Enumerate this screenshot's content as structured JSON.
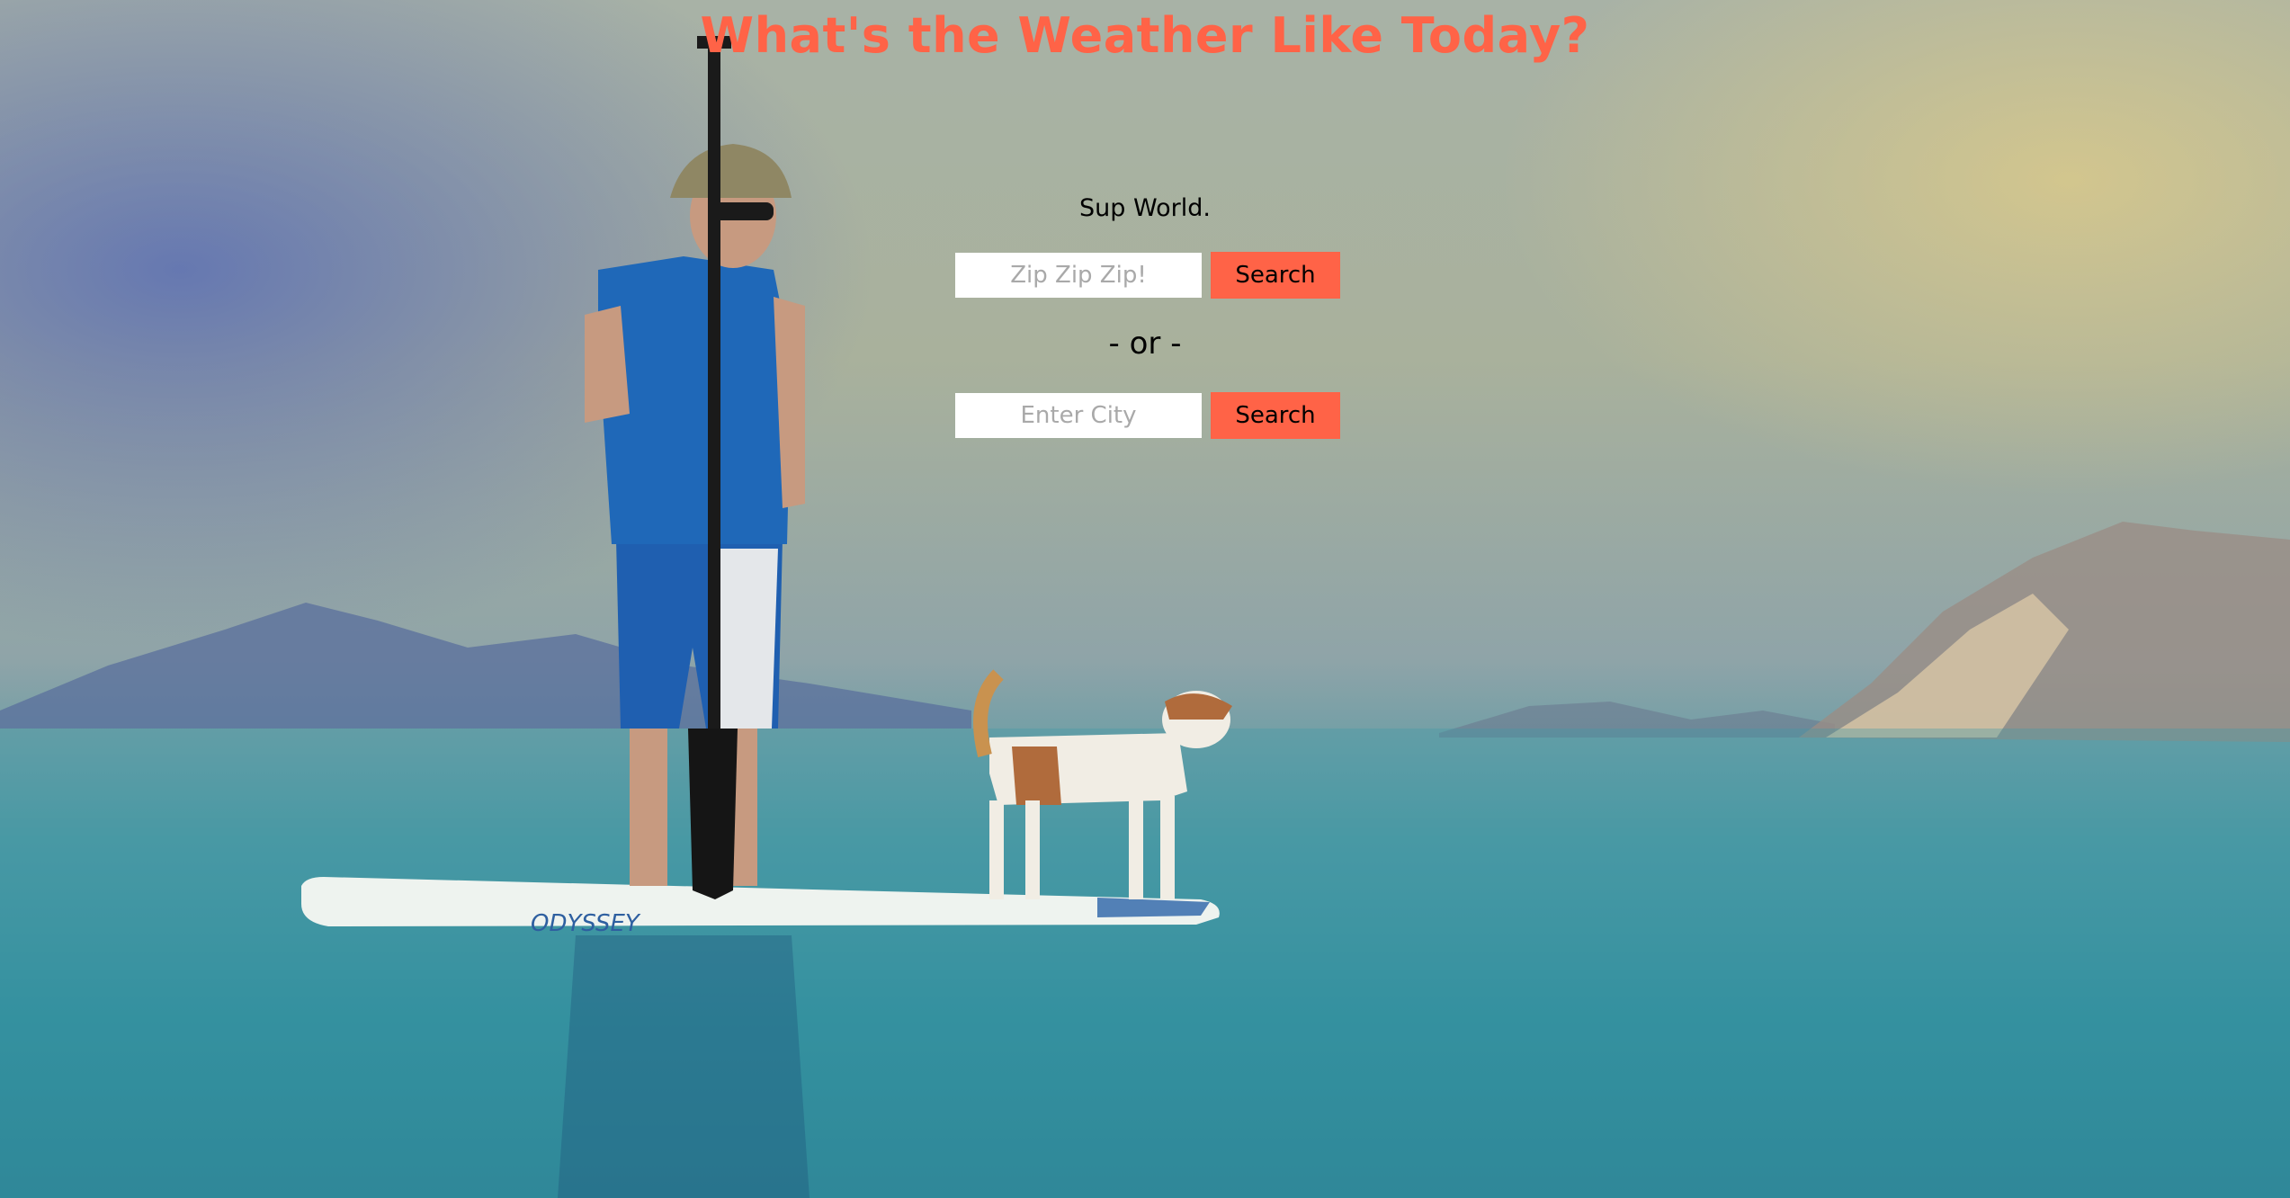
{
  "header": {
    "title": "What's the Weather Like Today?",
    "subtitle": "Sup World."
  },
  "zip_search": {
    "placeholder": "Zip Zip Zip!",
    "value": "",
    "button_label": "Search"
  },
  "separator": {
    "text": "- or -"
  },
  "city_search": {
    "placeholder": "Enter City",
    "value": "",
    "button_label": "Search"
  },
  "background": {
    "board_text": "ODYSSEY"
  },
  "colors": {
    "accent": "#ff6347",
    "input_background": "#ffffff",
    "text": "#000000"
  }
}
